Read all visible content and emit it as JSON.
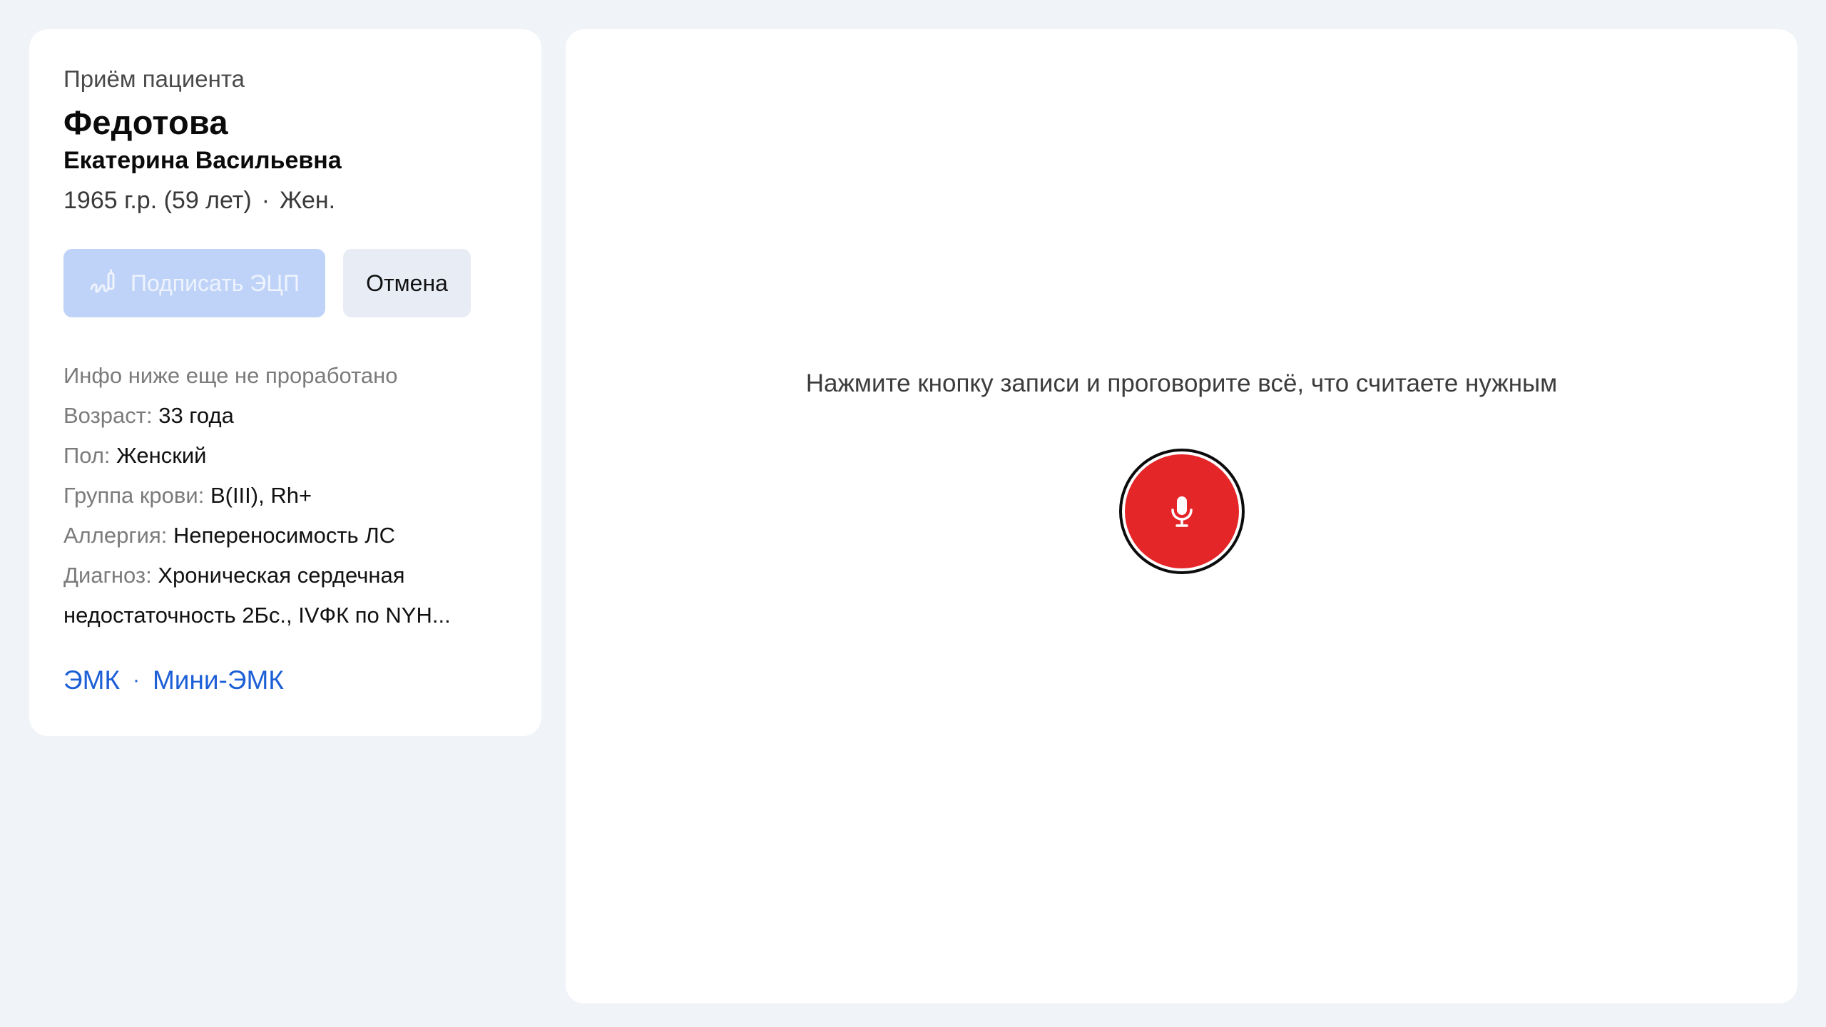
{
  "patient": {
    "eyebrow": "Приём пациента",
    "last_name": "Федотова",
    "first_names": "Екатерина Васильевна",
    "birth": "1965 г.р. (59 лет)",
    "sex_short": "Жен."
  },
  "actions": {
    "sign_label": "Подписать ЭЦП",
    "cancel_label": "Отмена"
  },
  "info": {
    "note": "Инфо ниже еще не проработано",
    "age_label": "Возраст:",
    "age_value": "33 года",
    "sex_label": "Пол:",
    "sex_value": "Женский",
    "blood_label": "Группа крови:",
    "blood_value": "B(III), Rh+",
    "allergy_label": "Аллергия:",
    "allergy_value": "Непереносимость ЛС",
    "diagnosis_label": "Диагноз:",
    "diagnosis_value": "Хроническая сердечная недостаточность 2Бс., IVФК по NYH..."
  },
  "links": {
    "emk": "ЭМК",
    "separator": "·",
    "mini_emk": "Мини-ЭМК"
  },
  "recorder": {
    "prompt": "Нажмите кнопку записи и проговорите всё, что считаете нужным",
    "button_icon": "microphone-icon",
    "button_color": "#e52629"
  },
  "colors": {
    "page_bg": "#f0f3f8",
    "accent_link": "#1d5fd6",
    "sign_button_disabled": "#bfd3f8"
  }
}
